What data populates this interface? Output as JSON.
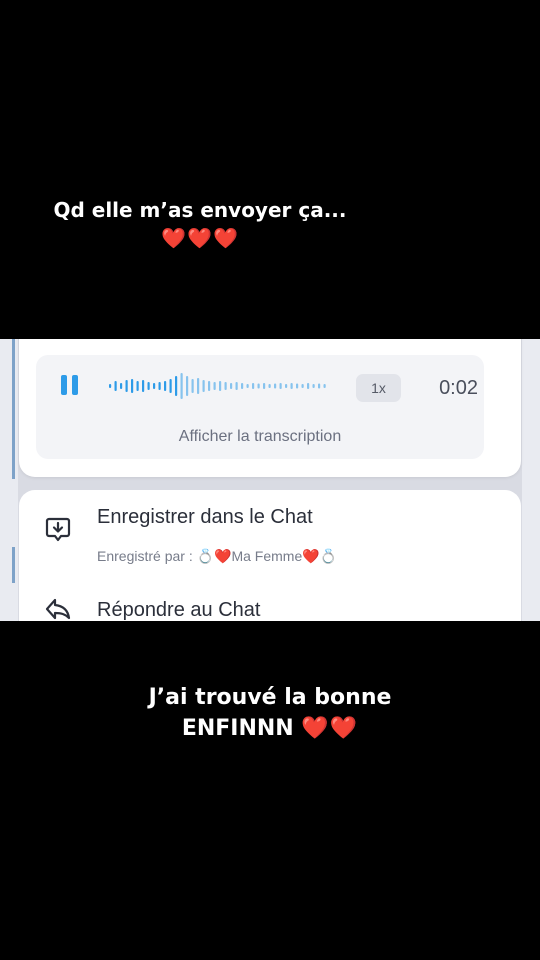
{
  "overlay": {
    "top_line": "Qd elle m’as envoyer ça...",
    "top_hearts": "❤️❤️❤️",
    "bottom_line1": "J’ai trouvé la bonne",
    "bottom_line2": "ENFINNN",
    "bottom_hearts": "❤️❤️"
  },
  "voice_message": {
    "state_icon": "pause-icon",
    "speed": "1x",
    "duration": "0:02",
    "transcription_link": "Afficher la transcription",
    "accent_color": "#2d9be8"
  },
  "actions": [
    {
      "title": "Enregistrer dans le Chat",
      "subtitle_prefix": "Enregistré par :",
      "subtitle_name": "💍❤️Ma Femme❤️💍",
      "icon": "save-to-chat-icon"
    },
    {
      "title": "Répondre au Chat",
      "icon": "reply-icon"
    }
  ]
}
